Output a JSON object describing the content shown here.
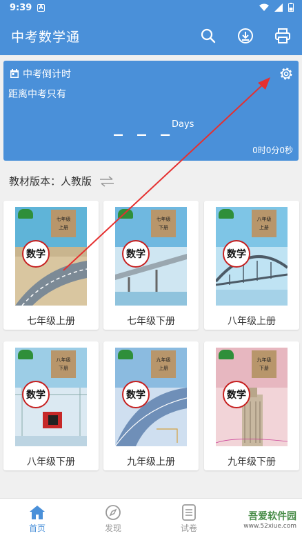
{
  "status_bar": {
    "time": "9:39",
    "notif_letter": "A"
  },
  "app_bar": {
    "title": "中考数学通",
    "actions": [
      "search-icon",
      "download-icon",
      "print-icon"
    ]
  },
  "countdown": {
    "title": "中考倒计时",
    "subtitle": "距离中考只有",
    "days_value": "_ _ _",
    "days_unit": "Days",
    "timer": "0时0分0秒"
  },
  "textbook": {
    "label": "教材版本：",
    "value": "人教版"
  },
  "books": [
    {
      "label": "七年级上册",
      "cover_grade": "七年级",
      "cover_term": "上册"
    },
    {
      "label": "七年级下册",
      "cover_grade": "七年级",
      "cover_term": "下册"
    },
    {
      "label": "八年级上册",
      "cover_grade": "八年级",
      "cover_term": "上册"
    },
    {
      "label": "八年级下册",
      "cover_grade": "八年级",
      "cover_term": "下册"
    },
    {
      "label": "九年级上册",
      "cover_grade": "九年级",
      "cover_term": "上册"
    },
    {
      "label": "九年级下册",
      "cover_grade": "九年级",
      "cover_term": "下册"
    }
  ],
  "cover_title": "数学",
  "bottom_nav": [
    {
      "label": "首页",
      "icon": "home-icon",
      "active": true
    },
    {
      "label": "发现",
      "icon": "compass-icon",
      "active": false
    },
    {
      "label": "试卷",
      "icon": "paper-icon",
      "active": false
    }
  ],
  "watermark": {
    "text": "吾爱软件园",
    "url": "www.52xiue.com"
  },
  "colors": {
    "primary": "#4a90d9",
    "annotation_arrow": "#e53030"
  }
}
